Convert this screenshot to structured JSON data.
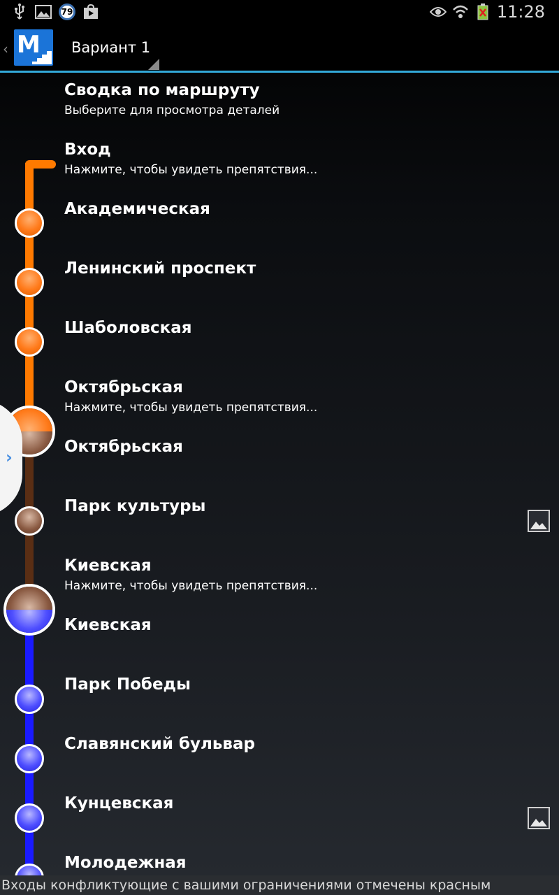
{
  "status_bar": {
    "battery_badge": "79",
    "time": "11:28",
    "left_icons": [
      "usb-icon",
      "image-icon",
      "battery-badge-icon",
      "store-icon"
    ],
    "right_icons": [
      "eye-icon",
      "wifi-icon",
      "battery-icon"
    ]
  },
  "action_bar": {
    "variant_label": "Вариант 1",
    "logo_letter": "M"
  },
  "colors": {
    "orange_line": "#ff7a00",
    "brown_line": "#5a2e14",
    "blue_line": "#1a1aff",
    "accent": "#33a9d9"
  },
  "route": {
    "summary": {
      "title": "Сводка по маршруту",
      "subtitle": "Выберите для просмотра деталей"
    },
    "items": [
      {
        "title": "Вход",
        "subtitle": "Нажмите, чтобы увидеть препятствия..."
      },
      {
        "title": "Академическая"
      },
      {
        "title": "Ленинский проспект"
      },
      {
        "title": "Шаболовская"
      },
      {
        "title": "Октябрьская",
        "subtitle": "Нажмите, чтобы увидеть препятствия..."
      },
      {
        "title": "Октябрьская"
      },
      {
        "title": "Парк культуры",
        "icon": "image-icon"
      },
      {
        "title": "Киевская",
        "subtitle": "Нажмите, чтобы увидеть препятствия..."
      },
      {
        "title": "Киевская"
      },
      {
        "title": "Парк Победы"
      },
      {
        "title": "Славянский бульвар"
      },
      {
        "title": "Кунцевская",
        "icon": "image-icon"
      },
      {
        "title": "Молодежная"
      }
    ]
  },
  "footer": {
    "text": "Входы конфликтующие с вашими ограничениями отмечены красным"
  }
}
